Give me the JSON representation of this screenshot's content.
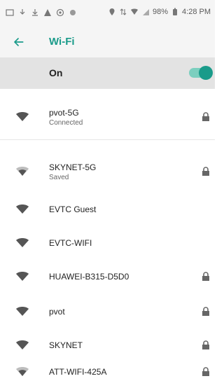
{
  "status": {
    "battery": "98%",
    "time": "4:28 PM"
  },
  "header": {
    "title": "Wi-Fi"
  },
  "toggle": {
    "label": "On",
    "state": "on"
  },
  "networks": [
    {
      "name": "pvot-5G",
      "status": "Connected",
      "secured": true,
      "signal": "strong"
    },
    {
      "name": "SKYNET-5G",
      "status": "Saved",
      "secured": true,
      "signal": "medium"
    },
    {
      "name": "EVTC Guest",
      "status": "",
      "secured": false,
      "signal": "strong"
    },
    {
      "name": "EVTC-WIFI",
      "status": "",
      "secured": false,
      "signal": "strong"
    },
    {
      "name": "HUAWEI-B315-D5D0",
      "status": "",
      "secured": true,
      "signal": "strong"
    },
    {
      "name": "pvot",
      "status": "",
      "secured": true,
      "signal": "strong"
    },
    {
      "name": "SKYNET",
      "status": "",
      "secured": true,
      "signal": "strong"
    },
    {
      "name": "ATT-WIFI-425A",
      "status": "",
      "secured": true,
      "signal": "medium"
    }
  ],
  "colors": {
    "accent": "#1a9b8a",
    "appbar": "#f5f5f5",
    "onbar": "#e3e3e3",
    "text": "#222222"
  },
  "icons": {
    "back": "back-arrow-icon",
    "wifi": "wifi-icon",
    "lock": "lock-icon"
  }
}
